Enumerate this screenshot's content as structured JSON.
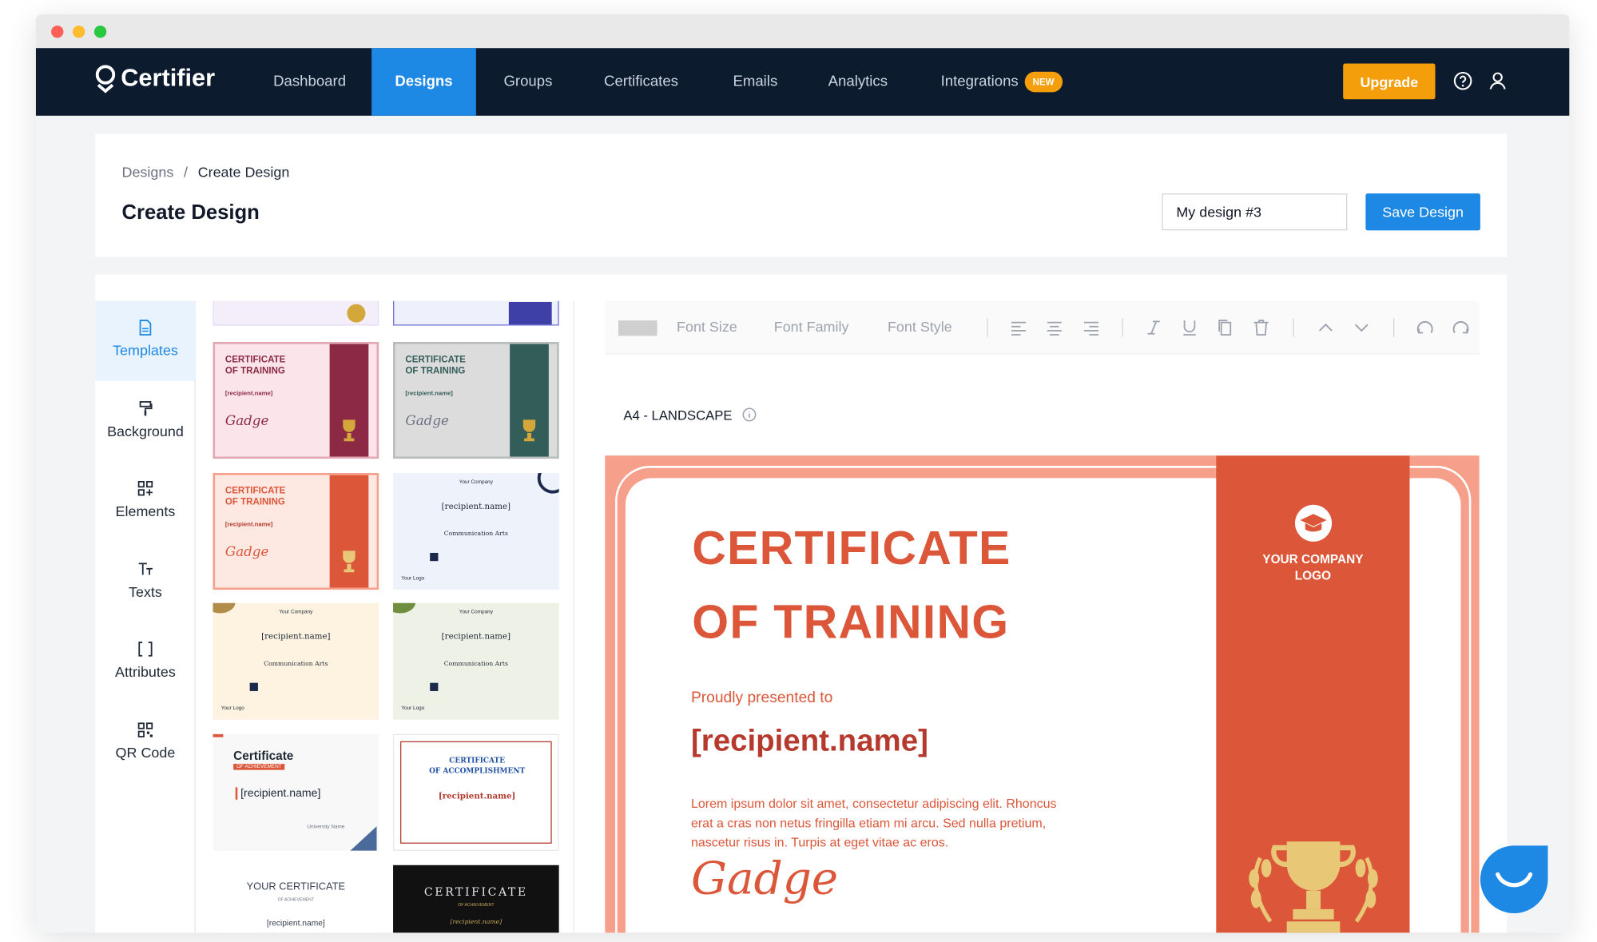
{
  "nav": {
    "brand": "Certifier",
    "items": [
      "Dashboard",
      "Designs",
      "Groups",
      "Certificates",
      "Emails",
      "Analytics",
      "Integrations"
    ],
    "active": "Designs",
    "new_badge": "NEW",
    "upgrade": "Upgrade"
  },
  "header": {
    "breadcrumb_parent": "Designs",
    "breadcrumb_sep": "/",
    "breadcrumb_current": "Create Design",
    "title": "Create Design",
    "design_name": "My design #3",
    "save": "Save Design"
  },
  "sidebar": {
    "items": [
      "Templates",
      "Background",
      "Elements",
      "Texts",
      "Attributes",
      "QR Code"
    ],
    "active": "Templates"
  },
  "toolbar": {
    "font_size": "Font Size",
    "font_family": "Font Family",
    "font_style": "Font Style"
  },
  "format": "A4 - LANDSCAPE",
  "thumbnails": {
    "training_1a": "CERTIFICATE",
    "training_1b": "OF TRAINING",
    "recipient_small": "[recipient.name]",
    "recipient_serif": "[recipient.name]",
    "company": "Your Company",
    "arts": "Communication Arts",
    "your_logo": "Your Logo",
    "cert_word": "Certificate",
    "of_achievement": "OF ACHIEVEMENT",
    "university": "University Name",
    "accomp_a": "CERTIFICATE",
    "accomp_b": "OF ACCOMPLISHMENT",
    "your_cert": "YOUR CERTIFICATE",
    "your_cert_sub": "OF ACHIEVEMENT",
    "dark_title": "CERTIFICATE",
    "dark_sub": "OF ACHIEVEMENT",
    "sign": "Gadge"
  },
  "certificate": {
    "title_line1": "CERTIFICATE",
    "title_line2": "OF TRAINING",
    "presented": "Proudly presented to",
    "recipient": "[recipient.name]",
    "lorem": "Lorem ipsum dolor sit amet, consectetur adipiscing elit. Rhoncus erat a cras non netus fringilla etiam mi arcu. Sed nulla pretium, nascetur risus in. Turpis at eget vitae ac eros.",
    "signature": "Gadge",
    "logo_line1": "YOUR COMPANY",
    "logo_line2": "LOGO"
  },
  "colors": {
    "nav_bg": "#0c1b2e",
    "accent": "#1e88e5",
    "upgrade": "#f59e0b",
    "cert_primary": "#dc5639",
    "cert_border": "#f6a08c"
  }
}
